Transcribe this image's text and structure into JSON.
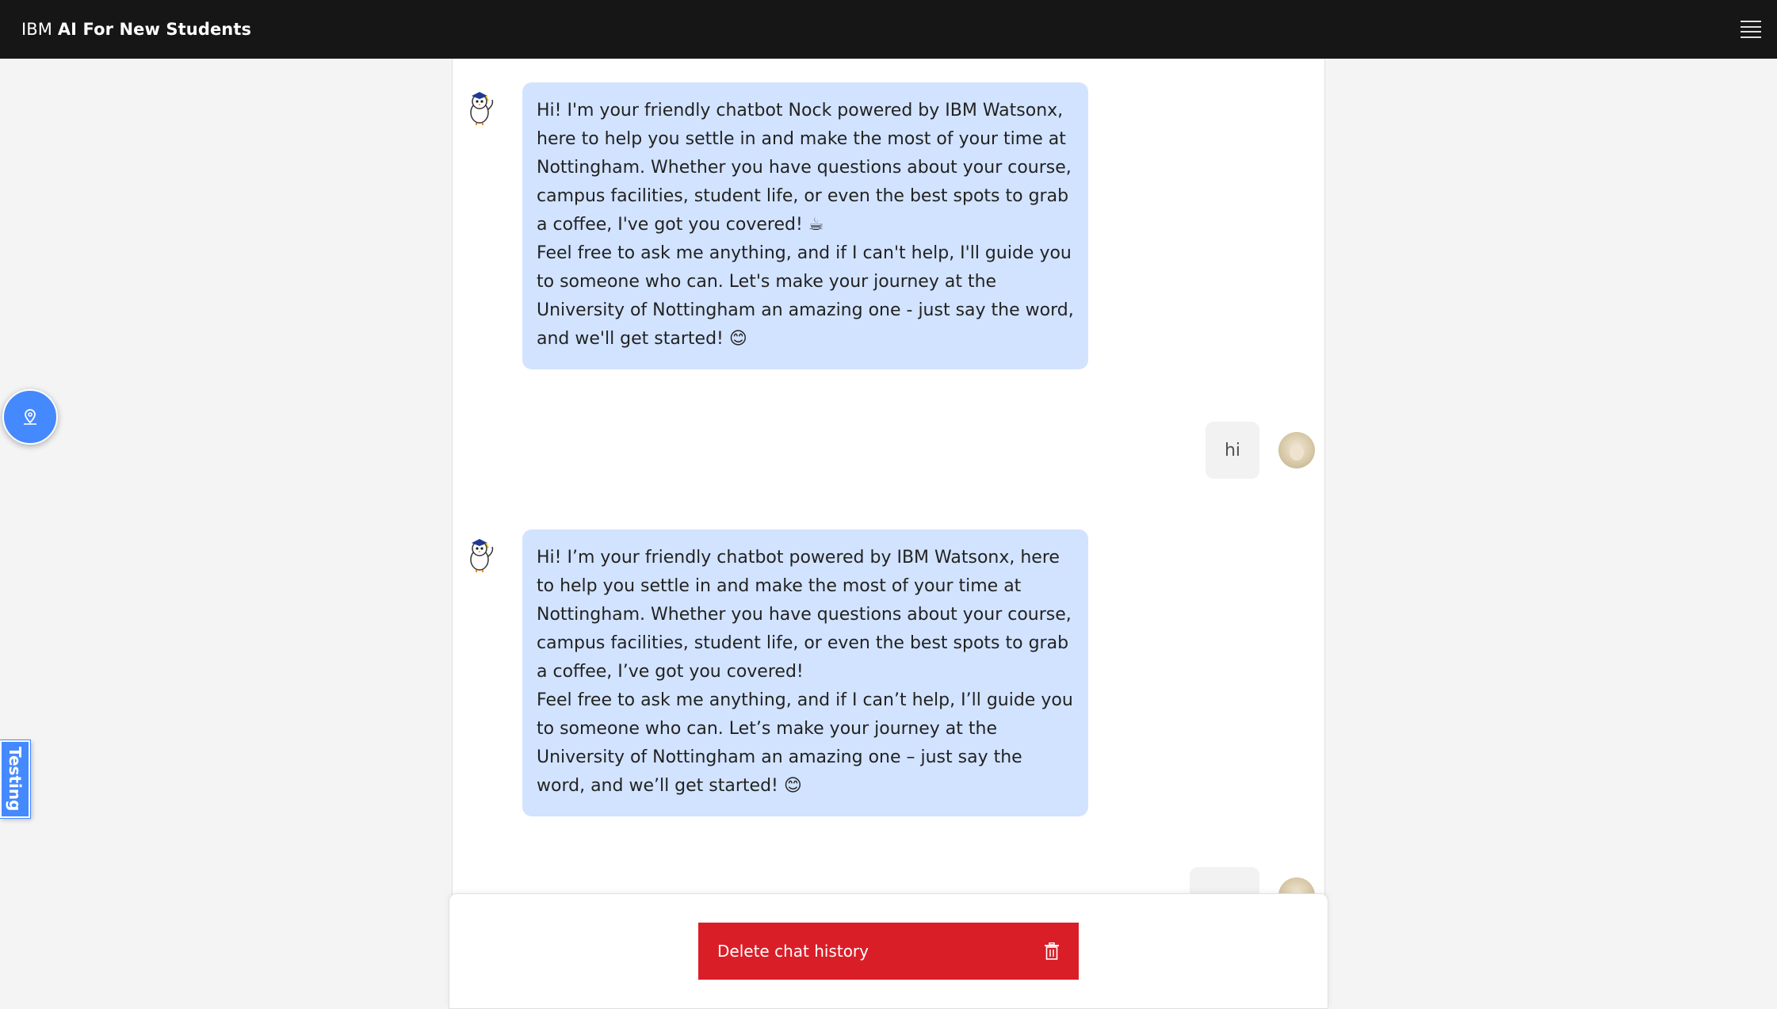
{
  "header": {
    "brand_prefix": "IBM",
    "brand_name": "AI For New Students",
    "menu_icon": "hamburger-menu-icon"
  },
  "messages": [
    {
      "role": "bot",
      "avatar_icon": "bird-mascot-icon",
      "paragraphs": [
        "Hi! I'm your friendly chatbot Nock powered by IBM Watsonx, here to help you settle in and make the most of your time at Nottingham. Whether you have questions about your course, campus facilities, student life, or even the best spots to grab a coffee, I've got you covered! ☕",
        "Feel free to ask me anything, and if I can't help, I'll guide you to someone who can. Let's make your journey at the University of Nottingham an amazing one - just say the word, and we'll get started! 😊"
      ]
    },
    {
      "role": "user",
      "text": "hi",
      "avatar_icon": "user-avatar-icon"
    },
    {
      "role": "bot",
      "avatar_icon": "bird-mascot-icon",
      "paragraphs": [
        "Hi! I’m your friendly chatbot powered by IBM Watsonx, here to help you settle in and make the most of your time at Nottingham. Whether you have questions about your course, campus facilities, student life, or even the best spots to grab a coffee, I’ve got you covered!",
        "Feel free to ask me anything, and if I can’t help, I’ll guide you to someone who can. Let’s make your journey at the University of Nottingham an amazing one – just say the word, and we’ll get started! 😊"
      ]
    }
  ],
  "footer": {
    "delete_label": "Delete chat history",
    "delete_icon": "trash-icon"
  },
  "widgets": {
    "floating_button_icon": "location-pin-icon",
    "side_tab_label": "Testing"
  },
  "colors": {
    "header_bg": "#161616",
    "bot_bubble": "#d0e2ff",
    "accent_blue": "#4589ff",
    "danger_red": "#da1e28"
  }
}
